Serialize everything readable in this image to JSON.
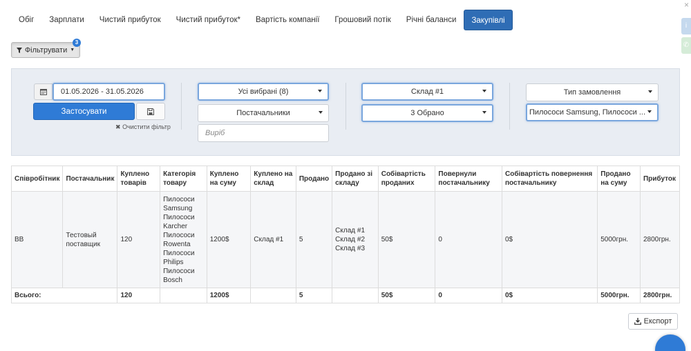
{
  "tabs": [
    {
      "label": "Обіг"
    },
    {
      "label": "Зарплати"
    },
    {
      "label": "Чистий прибуток"
    },
    {
      "label": "Чистий прибуток*"
    },
    {
      "label": "Вартість компанії"
    },
    {
      "label": "Грошовий потік"
    },
    {
      "label": "Річні баланси"
    },
    {
      "label": "Закупівлі"
    }
  ],
  "filter": {
    "button_label": "Фільтрувати",
    "badge": "3",
    "date_range": "01.05.2026 - 31.05.2026",
    "apply_label": "Застосувати",
    "clear_label": "Очистити фільтр",
    "all_selected": "Усі вибрані (8)",
    "suppliers": "Постачальники",
    "item_placeholder": "Виріб",
    "warehouse": "Склад #1",
    "selected_count": "3 Обрано",
    "order_type": "Тип замовлення",
    "products": "Пилососи Samsung, Пилососи ..."
  },
  "table": {
    "headers": [
      "Співробітник",
      "Постачальник",
      "Куплено товарів",
      "Категорія товару",
      "Куплено на суму",
      "Куплено на склад",
      "Продано",
      "Продано зі складу",
      "Собівартість проданих",
      "Повернули постачальнику",
      "Собівартість повернення постачальнику",
      "Продано на суму",
      "Прибуток"
    ],
    "row": {
      "employee": "ВВ",
      "supplier": "Тестовый поставщик",
      "bought_qty": "120",
      "categories": [
        "Пилососи Samsung",
        "Пилососи Karcher",
        "Пилососи Rowenta",
        "Пилососи Philips",
        "Пилососи Bosch"
      ],
      "bought_sum": "1200$",
      "bought_to_wh": "Склад #1",
      "sold": "5",
      "sold_from_wh": [
        "Склад #1",
        "Склад #2",
        "Склад #3"
      ],
      "cost_sold": "50$",
      "returned": "0",
      "cost_returned": "0$",
      "sold_sum": "5000грн.",
      "profit": "2800грн."
    },
    "total": {
      "label": "Всього:",
      "bought_qty": "120",
      "bought_sum": "1200$",
      "sold": "5",
      "cost_sold": "50$",
      "returned": "0",
      "cost_returned": "0$",
      "sold_sum": "5000грн.",
      "profit": "2800грн."
    }
  },
  "export_label": "Експорт",
  "colors": {
    "primary": "#2f7bd6",
    "active_tab": "#2f6db5",
    "panel_bg": "#e9edf3"
  }
}
